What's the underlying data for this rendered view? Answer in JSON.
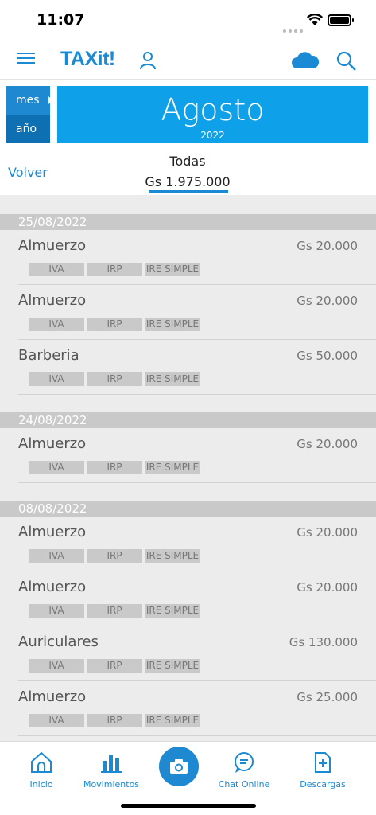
{
  "status_bar": {
    "time": "11:07"
  },
  "navbar": {
    "logo": "TAXit!"
  },
  "period": {
    "mes_label": "mes",
    "ano_label": "año",
    "month": "Agosto",
    "year": "2022"
  },
  "summary": {
    "back_label": "Volver",
    "filter_label": "Todas",
    "total": "Gs 1.975.000"
  },
  "tag_labels": {
    "iva": "IVA",
    "irp": "IRP",
    "ire": "IRE SIMPLE"
  },
  "groups": [
    {
      "date": "25/08/2022",
      "entries": [
        {
          "name": "Almuerzo",
          "amount": "Gs 20.000"
        },
        {
          "name": "Almuerzo",
          "amount": "Gs 20.000"
        },
        {
          "name": "Barberia",
          "amount": "Gs 50.000"
        }
      ]
    },
    {
      "date": "24/08/2022",
      "entries": [
        {
          "name": "Almuerzo",
          "amount": "Gs 20.000"
        }
      ]
    },
    {
      "date": "08/08/2022",
      "entries": [
        {
          "name": "Almuerzo",
          "amount": "Gs 20.000"
        },
        {
          "name": "Almuerzo",
          "amount": "Gs 20.000"
        },
        {
          "name": "Auriculares",
          "amount": "Gs 130.000"
        },
        {
          "name": "Almuerzo",
          "amount": "Gs 25.000"
        }
      ]
    }
  ],
  "tabbar": {
    "inicio": "Inicio",
    "movimientos": "Movimientos",
    "chat": "Chat Online",
    "descargas": "Descargas"
  },
  "colors": {
    "brand": "#1a8ad4",
    "month_banner": "#0ea0e8",
    "date_header": "#c9c9c9",
    "list_bg": "#ececec"
  }
}
